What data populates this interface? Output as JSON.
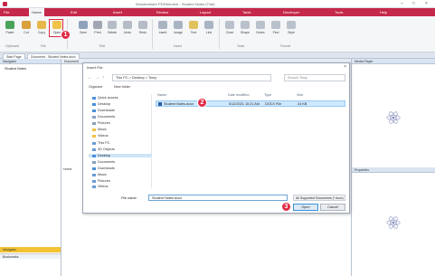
{
  "app": {
    "title": "Wondershare PDFelement - Student Notes (Trial)"
  },
  "ribbon_tabs": [
    "Home",
    "Edit",
    "Insert",
    "Review",
    "Layout",
    "Table",
    "Developer",
    "Tools",
    "Help"
  ],
  "ribbon_buttons": [
    "Paste",
    "Cut",
    "Copy",
    "Open",
    "Save",
    "Print",
    "Delete",
    "Undo",
    "Redo",
    "Insert",
    "Image",
    "Text",
    "Link",
    "Chart",
    "Shape",
    "Notes",
    "Find",
    "Style"
  ],
  "ribbon_groups": [
    "Clipboard",
    "File",
    "Edit",
    "Insert",
    "Tools",
    "Format"
  ],
  "doc_tabs": [
    "Start Page",
    "Document - Student Notes.docx"
  ],
  "left_pane": {
    "header": "Navigator",
    "first_item": "Student Notes",
    "bottom1": "Navigator",
    "bottom2": "Bookmarks"
  },
  "mid_pane": {
    "header": "Document",
    "side_label": "Home"
  },
  "right_pane": {
    "header_top": "Media Player",
    "header_bottom": "Properties"
  },
  "dialog": {
    "title": "Insert File",
    "address": "This PC  >  Desktop  >  Temp",
    "search_placeholder": "Search Temp",
    "toolbar": {
      "organize": "Organize",
      "new_folder": "New folder"
    },
    "nav_items": [
      "Quick access",
      "Desktop",
      "Downloads",
      "Documents",
      "Pictures",
      "Music",
      "Videos",
      "This PC",
      "3D Objects",
      "Desktop",
      "Documents",
      "Downloads",
      "Music",
      "Pictures",
      "Videos",
      "Network"
    ],
    "columns": {
      "name": "Name",
      "date": "Date modified",
      "type": "Type",
      "size": "Size"
    },
    "file": {
      "name": "Student Notes.docx",
      "date": "5/12/2021 10:21 AM",
      "type": "DOCX File",
      "size": "24 KB"
    },
    "filename_label": "File name:",
    "filename_value": "Student Notes.docx",
    "filetype": "All Supported Documents (*.docx)",
    "open_button": "Open",
    "cancel_button": "Cancel"
  },
  "callouts": [
    "1",
    "2",
    "3"
  ],
  "colors": {
    "accent": "#c5284a",
    "callout": "#e02a45",
    "selection": "#cde8ff"
  }
}
